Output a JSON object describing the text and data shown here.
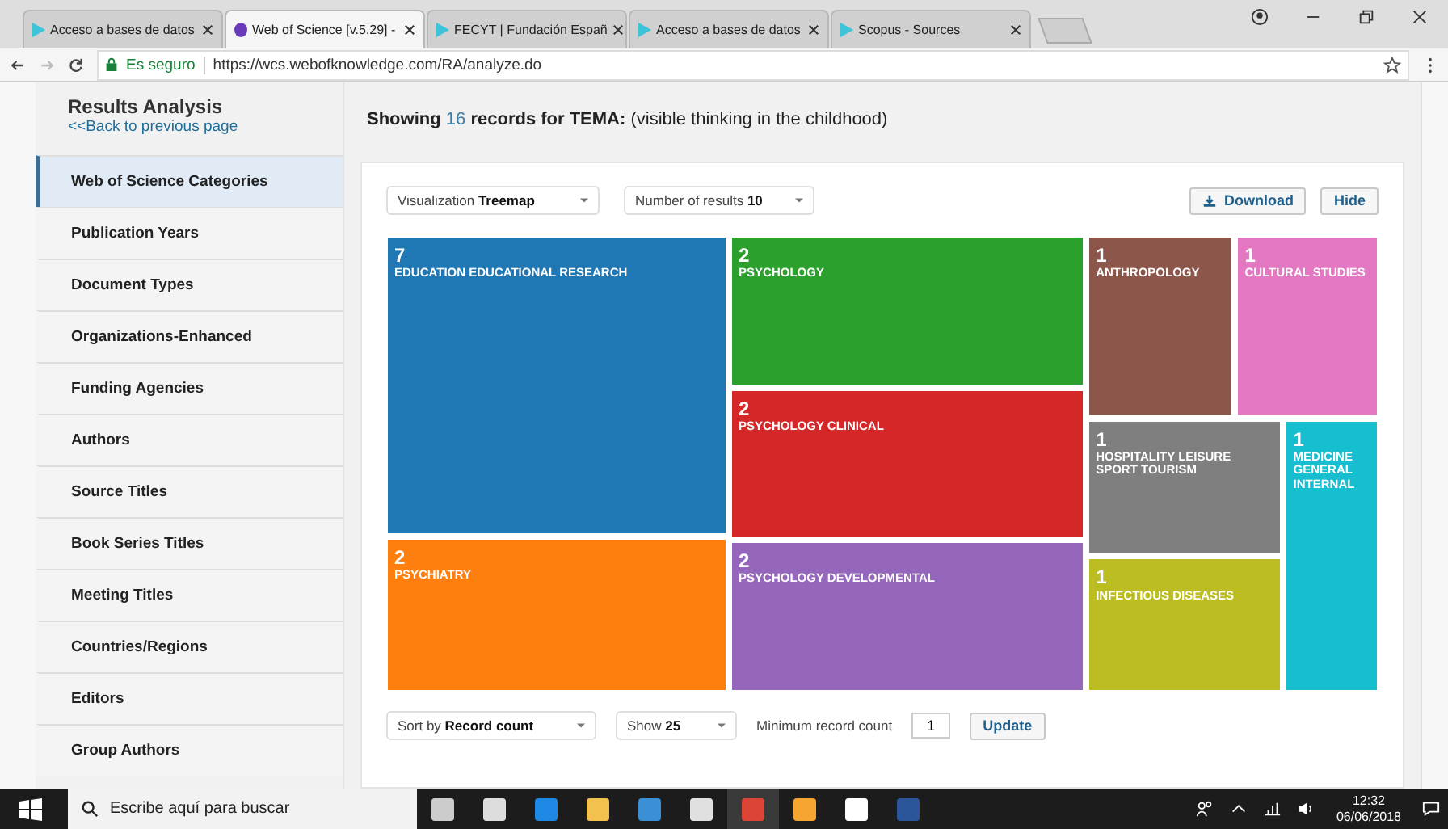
{
  "browser": {
    "tabs": [
      {
        "title": "Acceso a bases de datos",
        "selected": false
      },
      {
        "title": "Web of Science [v.5.29] -",
        "selected": true
      },
      {
        "title": "FECYT | Fundación Españ",
        "selected": false
      },
      {
        "title": "Acceso a bases de datos",
        "selected": false
      },
      {
        "title": "Scopus - Sources",
        "selected": false
      }
    ],
    "address": {
      "secure_label": "Es seguro",
      "url": "https://wcs.webofknowledge.com/RA/analyze.do"
    }
  },
  "sidebar": {
    "title": "Results Analysis",
    "back_link": "<<Back to previous page",
    "items": [
      {
        "label": "Web of Science Categories",
        "selected": true
      },
      {
        "label": "Publication Years",
        "selected": false
      },
      {
        "label": "Document Types",
        "selected": false
      },
      {
        "label": "Organizations-Enhanced",
        "selected": false
      },
      {
        "label": "Funding Agencies",
        "selected": false
      },
      {
        "label": "Authors",
        "selected": false
      },
      {
        "label": "Source Titles",
        "selected": false
      },
      {
        "label": "Book Series Titles",
        "selected": false
      },
      {
        "label": "Meeting Titles",
        "selected": false
      },
      {
        "label": "Countries/Regions",
        "selected": false
      },
      {
        "label": "Editors",
        "selected": false
      },
      {
        "label": "Group Authors",
        "selected": false
      }
    ]
  },
  "header": {
    "prefix": "Showing",
    "count": "16",
    "middle": "records for TEMA:",
    "query": "(visible thinking in the childhood)"
  },
  "controls": {
    "visualization": {
      "label": "Visualization",
      "value": "Treemap"
    },
    "results": {
      "label": "Number of results",
      "value": "10"
    },
    "download": "Download",
    "hide": "Hide"
  },
  "treemap": {
    "tiles": [
      {
        "count": "7",
        "label": "EDUCATION EDUCATIONAL RESEARCH",
        "color": "#1f77b4"
      },
      {
        "count": "2",
        "label": "PSYCHOLOGY",
        "color": "#2ca02c"
      },
      {
        "count": "2",
        "label": "PSYCHOLOGY CLINICAL",
        "color": "#d62728"
      },
      {
        "count": "2",
        "label": "PSYCHIATRY",
        "color": "#ff7f0e"
      },
      {
        "count": "2",
        "label": "PSYCHOLOGY DEVELOPMENTAL",
        "color": "#9467bd"
      },
      {
        "count": "1",
        "label": "ANTHROPOLOGY",
        "color": "#8c564b"
      },
      {
        "count": "1",
        "label": "CULTURAL STUDIES",
        "color": "#e377c2"
      },
      {
        "count": "1",
        "label": "HOSPITALITY LEISURE SPORT TOURISM",
        "color": "#7f7f7f"
      },
      {
        "count": "1",
        "label": "MEDICINE GENERAL INTERNAL",
        "color": "#17becf"
      },
      {
        "count": "1",
        "label": "INFECTIOUS DISEASES",
        "color": "#bcbd22"
      }
    ]
  },
  "bottom_controls": {
    "sort": {
      "label": "Sort by",
      "value": "Record count"
    },
    "show": {
      "label": "Show",
      "value": "25"
    },
    "min_count": {
      "label": "Minimum record count",
      "value": "1"
    },
    "update": "Update"
  },
  "taskbar": {
    "search_placeholder": "Escribe aquí para buscar",
    "time": "12:32",
    "date": "06/06/2018"
  }
}
